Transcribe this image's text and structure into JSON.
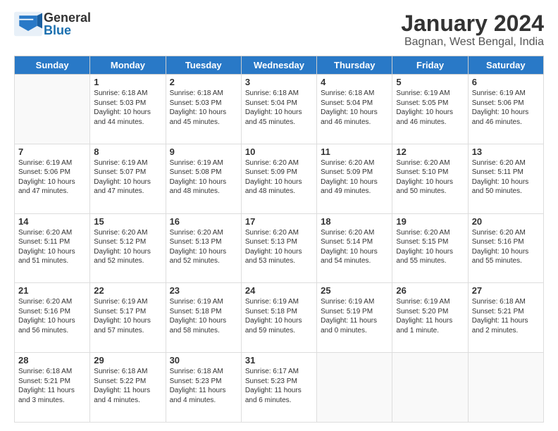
{
  "header": {
    "logo_general": "General",
    "logo_blue": "Blue",
    "title": "January 2024",
    "subtitle": "Bagnan, West Bengal, India"
  },
  "calendar": {
    "days_of_week": [
      "Sunday",
      "Monday",
      "Tuesday",
      "Wednesday",
      "Thursday",
      "Friday",
      "Saturday"
    ],
    "weeks": [
      [
        {
          "day": "",
          "info": ""
        },
        {
          "day": "1",
          "info": "Sunrise: 6:18 AM\nSunset: 5:03 PM\nDaylight: 10 hours\nand 44 minutes."
        },
        {
          "day": "2",
          "info": "Sunrise: 6:18 AM\nSunset: 5:03 PM\nDaylight: 10 hours\nand 45 minutes."
        },
        {
          "day": "3",
          "info": "Sunrise: 6:18 AM\nSunset: 5:04 PM\nDaylight: 10 hours\nand 45 minutes."
        },
        {
          "day": "4",
          "info": "Sunrise: 6:18 AM\nSunset: 5:04 PM\nDaylight: 10 hours\nand 46 minutes."
        },
        {
          "day": "5",
          "info": "Sunrise: 6:19 AM\nSunset: 5:05 PM\nDaylight: 10 hours\nand 46 minutes."
        },
        {
          "day": "6",
          "info": "Sunrise: 6:19 AM\nSunset: 5:06 PM\nDaylight: 10 hours\nand 46 minutes."
        }
      ],
      [
        {
          "day": "7",
          "info": "Sunrise: 6:19 AM\nSunset: 5:06 PM\nDaylight: 10 hours\nand 47 minutes."
        },
        {
          "day": "8",
          "info": "Sunrise: 6:19 AM\nSunset: 5:07 PM\nDaylight: 10 hours\nand 47 minutes."
        },
        {
          "day": "9",
          "info": "Sunrise: 6:19 AM\nSunset: 5:08 PM\nDaylight: 10 hours\nand 48 minutes."
        },
        {
          "day": "10",
          "info": "Sunrise: 6:20 AM\nSunset: 5:09 PM\nDaylight: 10 hours\nand 48 minutes."
        },
        {
          "day": "11",
          "info": "Sunrise: 6:20 AM\nSunset: 5:09 PM\nDaylight: 10 hours\nand 49 minutes."
        },
        {
          "day": "12",
          "info": "Sunrise: 6:20 AM\nSunset: 5:10 PM\nDaylight: 10 hours\nand 50 minutes."
        },
        {
          "day": "13",
          "info": "Sunrise: 6:20 AM\nSunset: 5:11 PM\nDaylight: 10 hours\nand 50 minutes."
        }
      ],
      [
        {
          "day": "14",
          "info": "Sunrise: 6:20 AM\nSunset: 5:11 PM\nDaylight: 10 hours\nand 51 minutes."
        },
        {
          "day": "15",
          "info": "Sunrise: 6:20 AM\nSunset: 5:12 PM\nDaylight: 10 hours\nand 52 minutes."
        },
        {
          "day": "16",
          "info": "Sunrise: 6:20 AM\nSunset: 5:13 PM\nDaylight: 10 hours\nand 52 minutes."
        },
        {
          "day": "17",
          "info": "Sunrise: 6:20 AM\nSunset: 5:13 PM\nDaylight: 10 hours\nand 53 minutes."
        },
        {
          "day": "18",
          "info": "Sunrise: 6:20 AM\nSunset: 5:14 PM\nDaylight: 10 hours\nand 54 minutes."
        },
        {
          "day": "19",
          "info": "Sunrise: 6:20 AM\nSunset: 5:15 PM\nDaylight: 10 hours\nand 55 minutes."
        },
        {
          "day": "20",
          "info": "Sunrise: 6:20 AM\nSunset: 5:16 PM\nDaylight: 10 hours\nand 55 minutes."
        }
      ],
      [
        {
          "day": "21",
          "info": "Sunrise: 6:20 AM\nSunset: 5:16 PM\nDaylight: 10 hours\nand 56 minutes."
        },
        {
          "day": "22",
          "info": "Sunrise: 6:19 AM\nSunset: 5:17 PM\nDaylight: 10 hours\nand 57 minutes."
        },
        {
          "day": "23",
          "info": "Sunrise: 6:19 AM\nSunset: 5:18 PM\nDaylight: 10 hours\nand 58 minutes."
        },
        {
          "day": "24",
          "info": "Sunrise: 6:19 AM\nSunset: 5:18 PM\nDaylight: 10 hours\nand 59 minutes."
        },
        {
          "day": "25",
          "info": "Sunrise: 6:19 AM\nSunset: 5:19 PM\nDaylight: 11 hours\nand 0 minutes."
        },
        {
          "day": "26",
          "info": "Sunrise: 6:19 AM\nSunset: 5:20 PM\nDaylight: 11 hours\nand 1 minute."
        },
        {
          "day": "27",
          "info": "Sunrise: 6:18 AM\nSunset: 5:21 PM\nDaylight: 11 hours\nand 2 minutes."
        }
      ],
      [
        {
          "day": "28",
          "info": "Sunrise: 6:18 AM\nSunset: 5:21 PM\nDaylight: 11 hours\nand 3 minutes."
        },
        {
          "day": "29",
          "info": "Sunrise: 6:18 AM\nSunset: 5:22 PM\nDaylight: 11 hours\nand 4 minutes."
        },
        {
          "day": "30",
          "info": "Sunrise: 6:18 AM\nSunset: 5:23 PM\nDaylight: 11 hours\nand 4 minutes."
        },
        {
          "day": "31",
          "info": "Sunrise: 6:17 AM\nSunset: 5:23 PM\nDaylight: 11 hours\nand 6 minutes."
        },
        {
          "day": "",
          "info": ""
        },
        {
          "day": "",
          "info": ""
        },
        {
          "day": "",
          "info": ""
        }
      ]
    ]
  }
}
